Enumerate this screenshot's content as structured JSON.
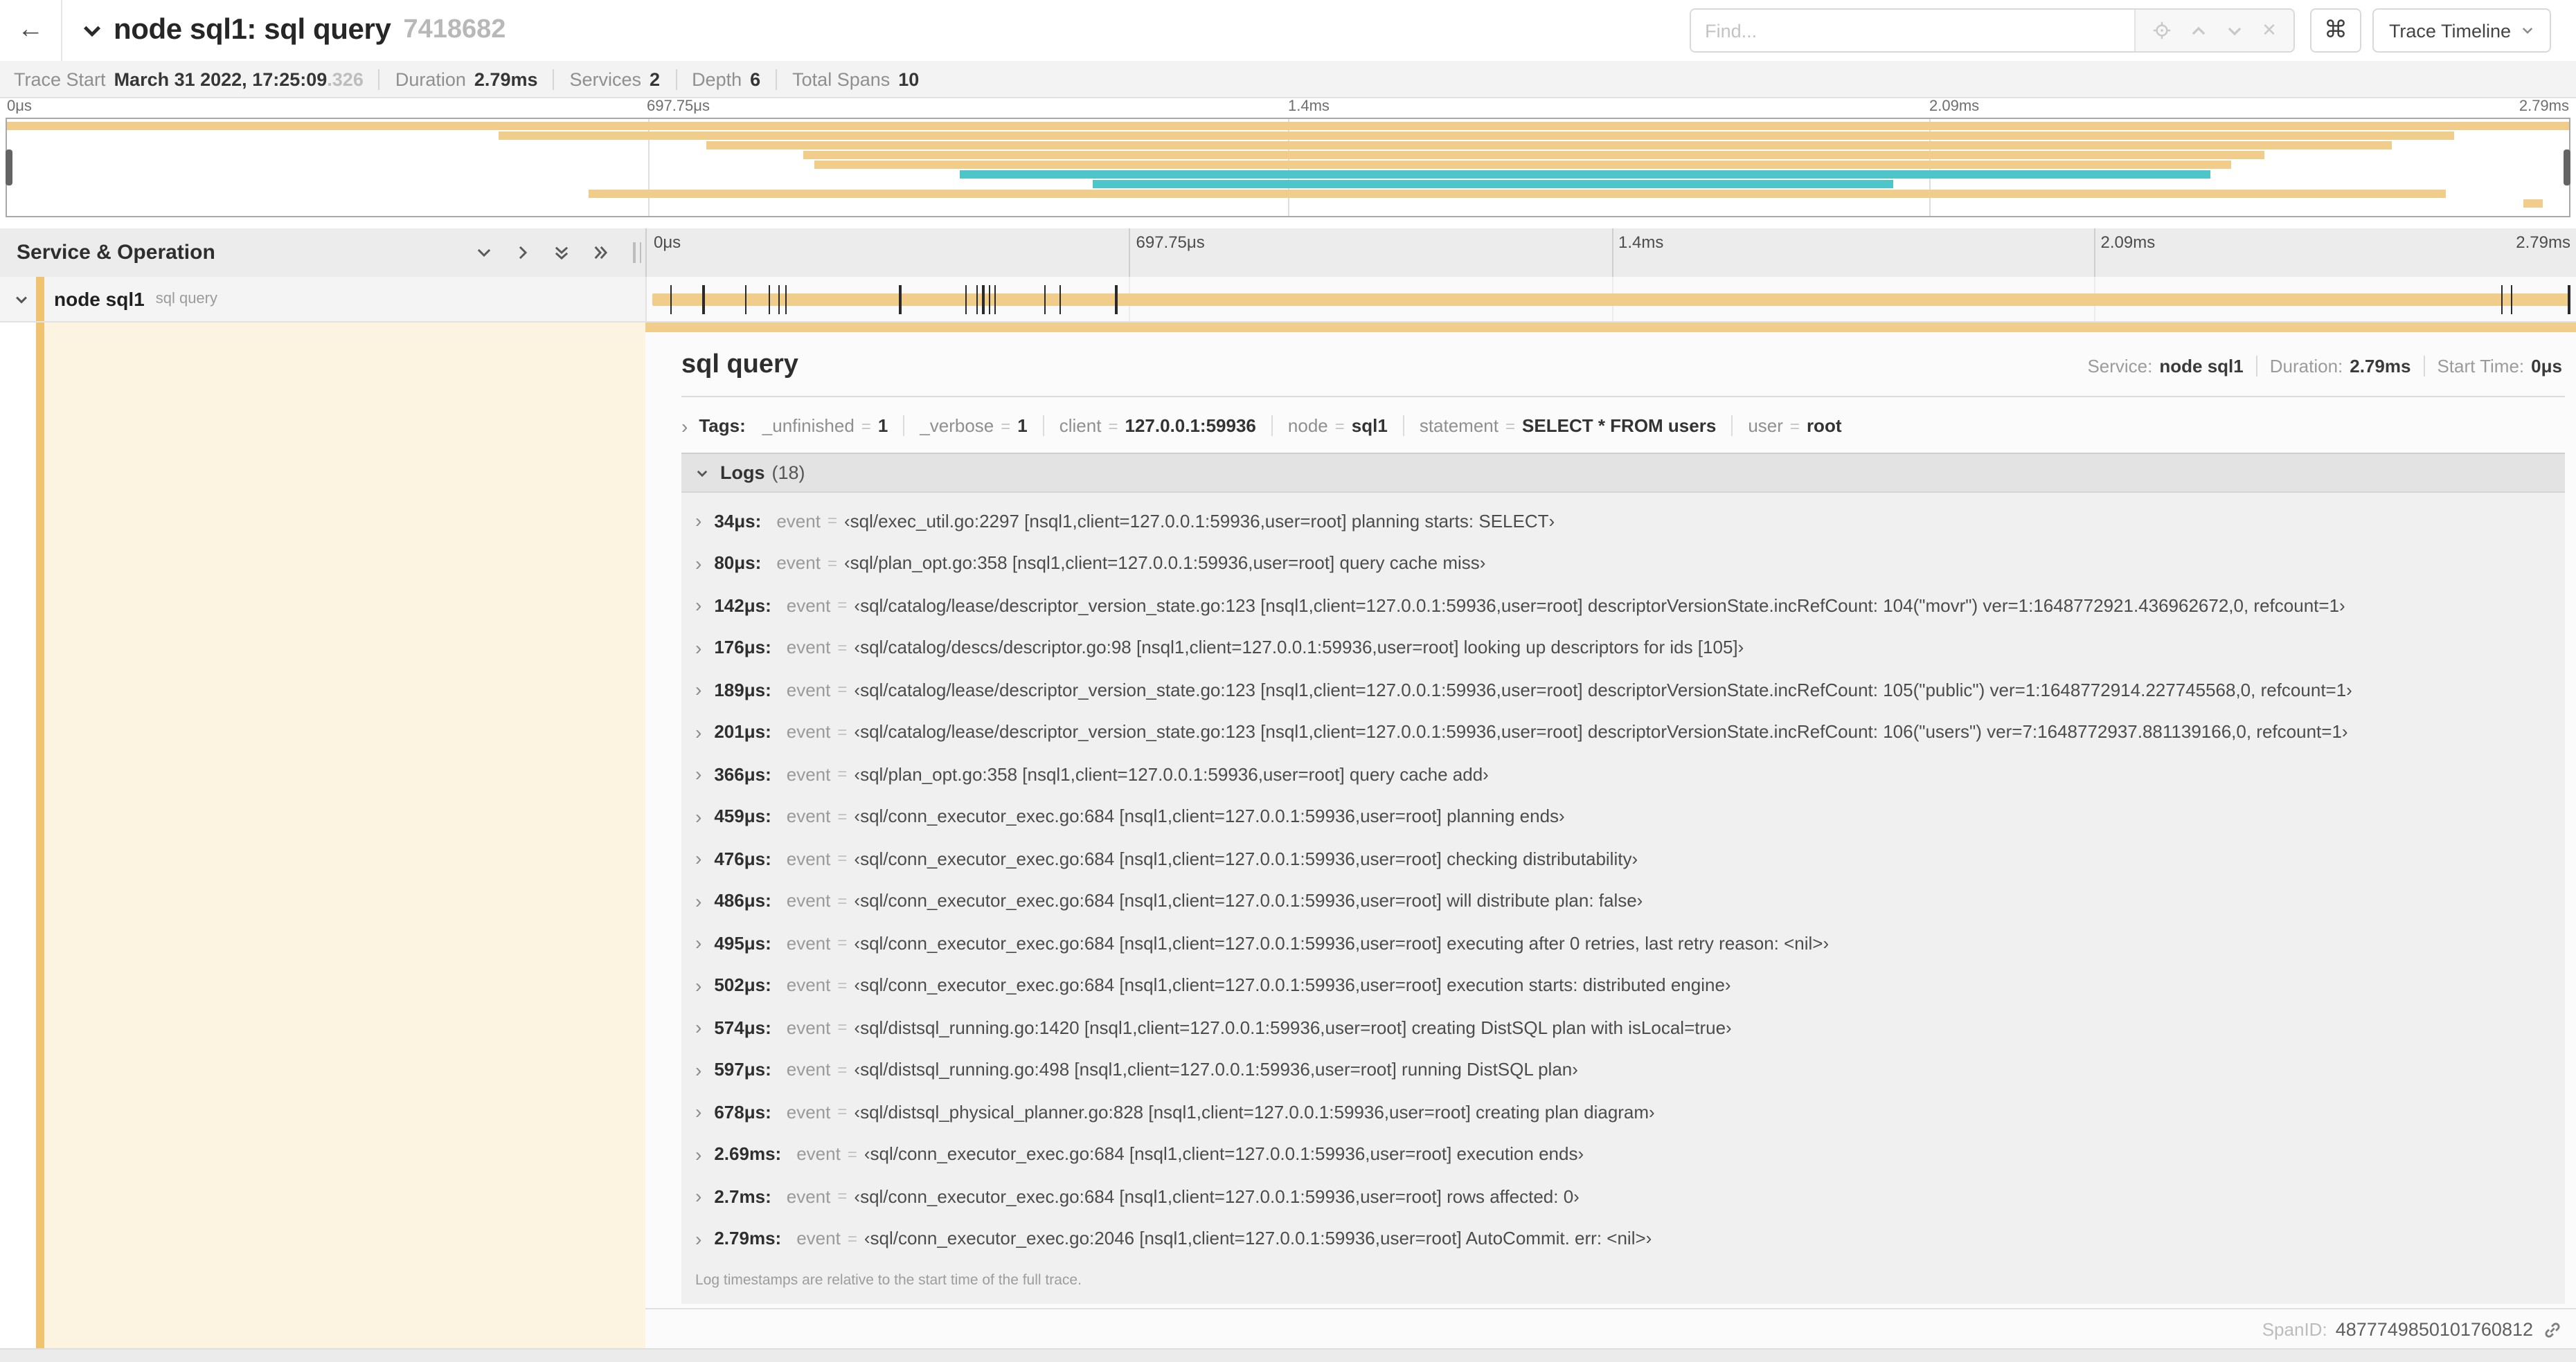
{
  "glyphs": {
    "back_arrow": "←",
    "chevron_right": "›",
    "command": "⌘",
    "close": "✕",
    "eq": "="
  },
  "colors": {
    "span_tan": "#f0cd8b",
    "span_tan_strip": "#efc36f",
    "span_teal": "#4dc5c9",
    "detail_cream": "#fcf4e0"
  },
  "header": {
    "title": "node sql1: sql query",
    "trace_id_short": "7418682",
    "find_placeholder": "Find...",
    "shortcut_button": "⌘",
    "view_selector_label": "Trace Timeline"
  },
  "summary": {
    "items": [
      {
        "label": "Trace Start",
        "value": "March 31 2022, 17:25:09",
        "suffix": ".326"
      },
      {
        "label": "Duration",
        "value": "2.79ms"
      },
      {
        "label": "Services",
        "value": "2"
      },
      {
        "label": "Depth",
        "value": "6"
      },
      {
        "label": "Total Spans",
        "value": "10"
      }
    ]
  },
  "minimap": {
    "axis_labels": [
      "0μs",
      "697.75μs",
      "1.4ms",
      "2.09ms",
      "2.79ms"
    ],
    "rows": [
      {
        "color": "#f0cd8b",
        "left": "0%",
        "width": "100%"
      },
      {
        "color": "#f0cd8b",
        "left": "19.2%",
        "width": "76.3%"
      },
      {
        "color": "#f0cd8b",
        "left": "27.3%",
        "width": "65.8%"
      },
      {
        "color": "#f0cd8b",
        "left": "31.1%",
        "width": "57%"
      },
      {
        "color": "#f0cd8b",
        "left": "31.5%",
        "width": "55.3%"
      },
      {
        "color": "#4dc5c9",
        "left": "37.2%",
        "width": "48.8%"
      },
      {
        "color": "#4dc5c9",
        "left": "42.4%",
        "width": "31.2%"
      },
      {
        "color": "#f0cd8b",
        "left": "22.7%",
        "width": "72.5%"
      },
      {
        "color": "#f0cd8b",
        "left": "98.2%",
        "width": "0.8%"
      }
    ]
  },
  "timeline": {
    "left_header": "Service & Operation",
    "axis_labels": [
      "0μs",
      "697.75μs",
      "1.4ms",
      "2.09ms",
      "2.79ms"
    ],
    "span": {
      "service": "node sql1",
      "operation": "sql query",
      "tick_positions": [
        "1.2%",
        "2.9%",
        "5.1%",
        "6.3%",
        "6.8%",
        "7.2%",
        "13.1%",
        "16.5%",
        "17.1%",
        "17.4%",
        "17.7%",
        "18%",
        "20.6%",
        "21.4%",
        "24.3%",
        "96.1%",
        "96.6%",
        "99.6%"
      ]
    }
  },
  "detail": {
    "title": "sql query",
    "meta": [
      {
        "label": "Service:",
        "value": "node sql1"
      },
      {
        "label": "Duration:",
        "value": "2.79ms"
      },
      {
        "label": "Start Time:",
        "value": "0μs"
      }
    ],
    "tags_label": "Tags:",
    "tags": [
      {
        "key": "_unfinished",
        "value": "1"
      },
      {
        "key": "_verbose",
        "value": "1"
      },
      {
        "key": "client",
        "value": "127.0.0.1:59936"
      },
      {
        "key": "node",
        "value": "sql1"
      },
      {
        "key": "statement",
        "value": "SELECT * FROM users"
      },
      {
        "key": "user",
        "value": "root"
      }
    ],
    "logs_label": "Logs",
    "logs_count": "(18)",
    "log_key": "event",
    "logs": [
      {
        "time": "34μs:",
        "value": "‹sql/exec_util.go:2297 [nsql1,client=127.0.0.1:59936,user=root] planning starts: SELECT›"
      },
      {
        "time": "80μs:",
        "value": "‹sql/plan_opt.go:358 [nsql1,client=127.0.0.1:59936,user=root] query cache miss›"
      },
      {
        "time": "142μs:",
        "value": "‹sql/catalog/lease/descriptor_version_state.go:123 [nsql1,client=127.0.0.1:59936,user=root] descriptorVersionState.incRefCount: 104(\"movr\") ver=1:1648772921.436962672,0, refcount=1›"
      },
      {
        "time": "176μs:",
        "value": "‹sql/catalog/descs/descriptor.go:98 [nsql1,client=127.0.0.1:59936,user=root] looking up descriptors for ids [105]›"
      },
      {
        "time": "189μs:",
        "value": "‹sql/catalog/lease/descriptor_version_state.go:123 [nsql1,client=127.0.0.1:59936,user=root] descriptorVersionState.incRefCount: 105(\"public\") ver=1:1648772914.227745568,0, refcount=1›"
      },
      {
        "time": "201μs:",
        "value": "‹sql/catalog/lease/descriptor_version_state.go:123 [nsql1,client=127.0.0.1:59936,user=root] descriptorVersionState.incRefCount: 106(\"users\") ver=7:1648772937.881139166,0, refcount=1›"
      },
      {
        "time": "366μs:",
        "value": "‹sql/plan_opt.go:358 [nsql1,client=127.0.0.1:59936,user=root] query cache add›"
      },
      {
        "time": "459μs:",
        "value": "‹sql/conn_executor_exec.go:684 [nsql1,client=127.0.0.1:59936,user=root] planning ends›"
      },
      {
        "time": "476μs:",
        "value": "‹sql/conn_executor_exec.go:684 [nsql1,client=127.0.0.1:59936,user=root] checking distributability›"
      },
      {
        "time": "486μs:",
        "value": "‹sql/conn_executor_exec.go:684 [nsql1,client=127.0.0.1:59936,user=root] will distribute plan: false›"
      },
      {
        "time": "495μs:",
        "value": "‹sql/conn_executor_exec.go:684 [nsql1,client=127.0.0.1:59936,user=root] executing after 0 retries, last retry reason: <nil>›"
      },
      {
        "time": "502μs:",
        "value": "‹sql/conn_executor_exec.go:684 [nsql1,client=127.0.0.1:59936,user=root] execution starts: distributed engine›"
      },
      {
        "time": "574μs:",
        "value": "‹sql/distsql_running.go:1420 [nsql1,client=127.0.0.1:59936,user=root] creating DistSQL plan with isLocal=true›"
      },
      {
        "time": "597μs:",
        "value": "‹sql/distsql_running.go:498 [nsql1,client=127.0.0.1:59936,user=root] running DistSQL plan›"
      },
      {
        "time": "678μs:",
        "value": "‹sql/distsql_physical_planner.go:828 [nsql1,client=127.0.0.1:59936,user=root] creating plan diagram›"
      },
      {
        "time": "2.69ms:",
        "value": "‹sql/conn_executor_exec.go:684 [nsql1,client=127.0.0.1:59936,user=root] execution ends›"
      },
      {
        "time": "2.7ms:",
        "value": "‹sql/conn_executor_exec.go:684 [nsql1,client=127.0.0.1:59936,user=root] rows affected: 0›"
      },
      {
        "time": "2.79ms:",
        "value": "‹sql/conn_executor_exec.go:2046 [nsql1,client=127.0.0.1:59936,user=root] AutoCommit. err: <nil>›"
      }
    ],
    "footnote": "Log timestamps are relative to the start time of the full trace.",
    "span_id_label": "SpanID:",
    "span_id": "4877749850101760812"
  }
}
